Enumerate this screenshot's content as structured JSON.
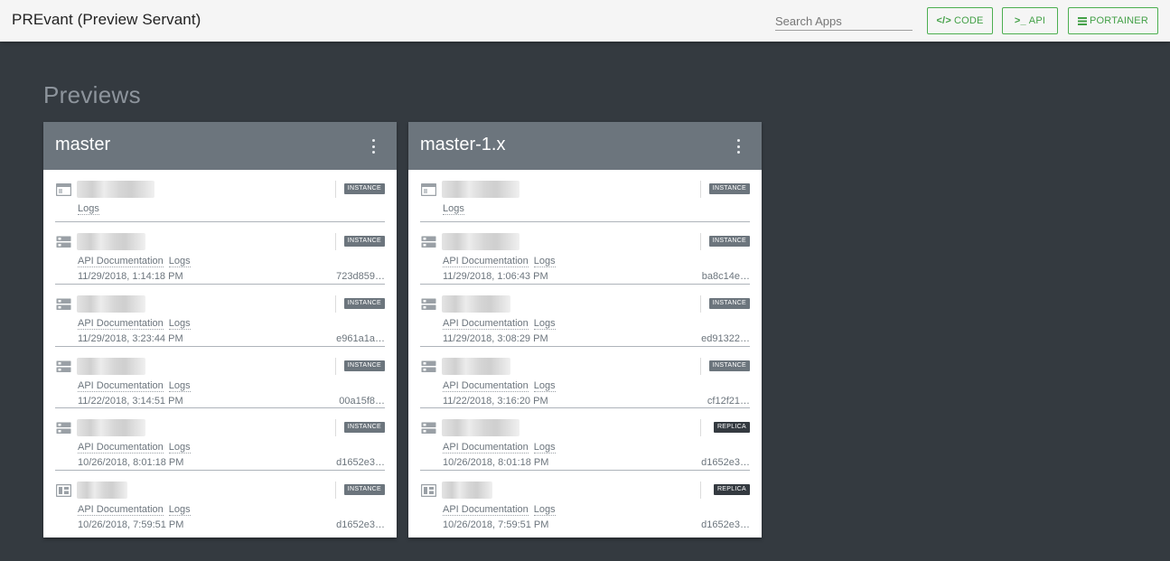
{
  "app": {
    "title": "PREvant (Preview Servant)"
  },
  "search": {
    "placeholder": "Search Apps",
    "value": ""
  },
  "nav": {
    "code_label": "Code",
    "api_label": "API",
    "portainer_label": "Portainer",
    "code_icon": "</>",
    "api_icon": ">_"
  },
  "section": {
    "title": "Previews"
  },
  "colors": {
    "background": "#343a40",
    "card_header": "#6c757d",
    "accent": "#4caf50",
    "badge_instance": "#6c757d",
    "badge_replica": "#343a40"
  },
  "cards": [
    {
      "title": "master",
      "services": [
        {
          "icon": "web-icon",
          "badge": "INSTANCE",
          "links": [
            "Logs"
          ],
          "date": "",
          "hash": ""
        },
        {
          "icon": "server-icon",
          "badge": "INSTANCE",
          "links": [
            "API Documentation",
            "Logs"
          ],
          "date": "11/29/2018, 1:14:18 PM",
          "hash": "723d859…"
        },
        {
          "icon": "server-icon",
          "badge": "INSTANCE",
          "links": [
            "API Documentation",
            "Logs"
          ],
          "date": "11/29/2018, 3:23:44 PM",
          "hash": "e961a1a…"
        },
        {
          "icon": "server-icon",
          "badge": "INSTANCE",
          "links": [
            "API Documentation",
            "Logs"
          ],
          "date": "11/22/2018, 3:14:51 PM",
          "hash": "00a15f8…"
        },
        {
          "icon": "server-icon",
          "badge": "INSTANCE",
          "links": [
            "API Documentation",
            "Logs"
          ],
          "date": "10/26/2018, 8:01:18 PM",
          "hash": "d1652e3…"
        },
        {
          "icon": "dashboard-icon",
          "badge": "INSTANCE",
          "links": [
            "API Documentation",
            "Logs"
          ],
          "date": "10/26/2018, 7:59:51 PM",
          "hash": "d1652e3…"
        }
      ]
    },
    {
      "title": "master-1.x",
      "services": [
        {
          "icon": "web-icon",
          "badge": "INSTANCE",
          "links": [
            "Logs"
          ],
          "date": "",
          "hash": ""
        },
        {
          "icon": "server-icon",
          "badge": "INSTANCE",
          "links": [
            "API Documentation",
            "Logs"
          ],
          "date": "11/29/2018, 1:06:43 PM",
          "hash": "ba8c14e…"
        },
        {
          "icon": "server-icon",
          "badge": "INSTANCE",
          "links": [
            "API Documentation",
            "Logs"
          ],
          "date": "11/29/2018, 3:08:29 PM",
          "hash": "ed91322…"
        },
        {
          "icon": "server-icon",
          "badge": "INSTANCE",
          "links": [
            "API Documentation",
            "Logs"
          ],
          "date": "11/22/2018, 3:16:20 PM",
          "hash": "cf12f21…"
        },
        {
          "icon": "server-icon",
          "badge": "REPLICA",
          "links": [
            "API Documentation",
            "Logs"
          ],
          "date": "10/26/2018, 8:01:18 PM",
          "hash": "d1652e3…"
        },
        {
          "icon": "dashboard-icon",
          "badge": "REPLICA",
          "links": [
            "API Documentation",
            "Logs"
          ],
          "date": "10/26/2018, 7:59:51 PM",
          "hash": "d1652e3…"
        }
      ]
    }
  ]
}
